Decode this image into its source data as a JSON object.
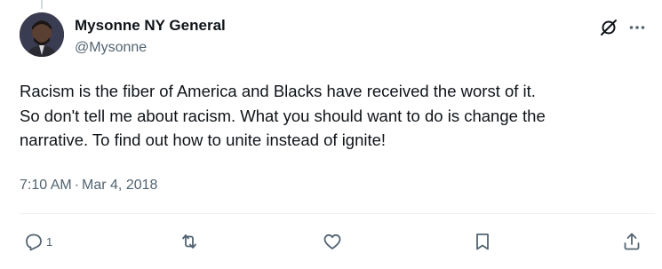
{
  "author": {
    "display_name": "Mysonne NY General",
    "handle": "@Mysonne"
  },
  "tweet": {
    "text": "Racism is the fiber of America and Blacks have received the worst of it.\nSo don't tell me about racism. What you should want to do is change the\nnarrative. To find out how to unite instead of ignite!",
    "time": "7:10 AM",
    "separator": "·",
    "date": "Mar 4, 2018"
  },
  "actions": {
    "reply": {
      "icon": "reply-icon",
      "count": "1"
    },
    "retweet": {
      "icon": "retweet-icon"
    },
    "like": {
      "icon": "heart-icon"
    },
    "bookmark": {
      "icon": "bookmark-icon"
    },
    "share": {
      "icon": "share-icon"
    }
  },
  "header_icons": [
    "grok-icon",
    "more-options-icon"
  ],
  "colors": {
    "text_primary": "#0f1419",
    "text_secondary": "#536471",
    "divider": "#eff3f4"
  }
}
